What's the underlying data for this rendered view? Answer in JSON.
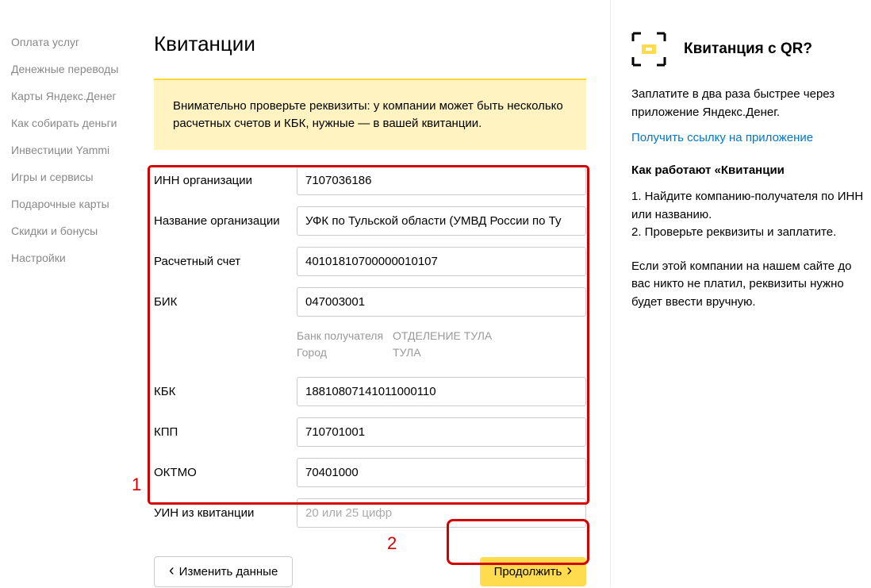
{
  "sidebar": {
    "items": [
      {
        "label": "Оплата услуг"
      },
      {
        "label": "Денежные переводы"
      },
      {
        "label": "Карты Яндекс.Денег"
      },
      {
        "label": "Как собирать деньги"
      },
      {
        "label": "Инвестиции Yammi"
      },
      {
        "label": "Игры и сервисы"
      },
      {
        "label": "Подарочные карты"
      },
      {
        "label": "Скидки и бонусы"
      },
      {
        "label": "Настройки"
      }
    ]
  },
  "page": {
    "title": "Квитанции",
    "alert": "Внимательно проверьте реквизиты: у компании может быть несколько расчетных счетов и КБК, нужные — в вашей квитанции."
  },
  "form": {
    "inn": {
      "label": "ИНН организации",
      "value": "7107036186"
    },
    "org": {
      "label": "Название организации",
      "value": "УФК по Тульской области (УМВД России по Ту"
    },
    "account": {
      "label": "Расчетный счет",
      "value": "40101810700000010107"
    },
    "bik": {
      "label": "БИК",
      "value": "047003001"
    },
    "bank_info": {
      "bank_label": "Банк получателя",
      "bank_value": "ОТДЕЛЕНИЕ ТУЛА",
      "city_label": "Город",
      "city_value": "ТУЛА"
    },
    "kbk": {
      "label": "КБК",
      "value": "18810807141011000110"
    },
    "kpp": {
      "label": "КПП",
      "value": "710701001"
    },
    "oktmo": {
      "label": "ОКТМО",
      "value": "70401000"
    },
    "uin": {
      "label": "УИН из квитанции",
      "value": "",
      "placeholder": "20 или 25 цифр"
    }
  },
  "actions": {
    "back": "Изменить данные",
    "continue": "Продолжить"
  },
  "annotations": {
    "num1": "1",
    "num2": "2"
  },
  "aside": {
    "qr_title": "Квитанция с QR?",
    "lead": "Заплатите в два раза быстрее через приложение Яндекс.Денег.",
    "link": "Получить ссылку на приложение",
    "subtitle": "Как работают «Квитанции",
    "step1": "1. Найдите компанию-получателя по ИНН или названию.",
    "step2": "2. Проверьте реквизиты и заплатите.",
    "note": "Если этой компании на нашем сайте до вас никто не платил, реквизиты нужно будет ввести вручную."
  }
}
